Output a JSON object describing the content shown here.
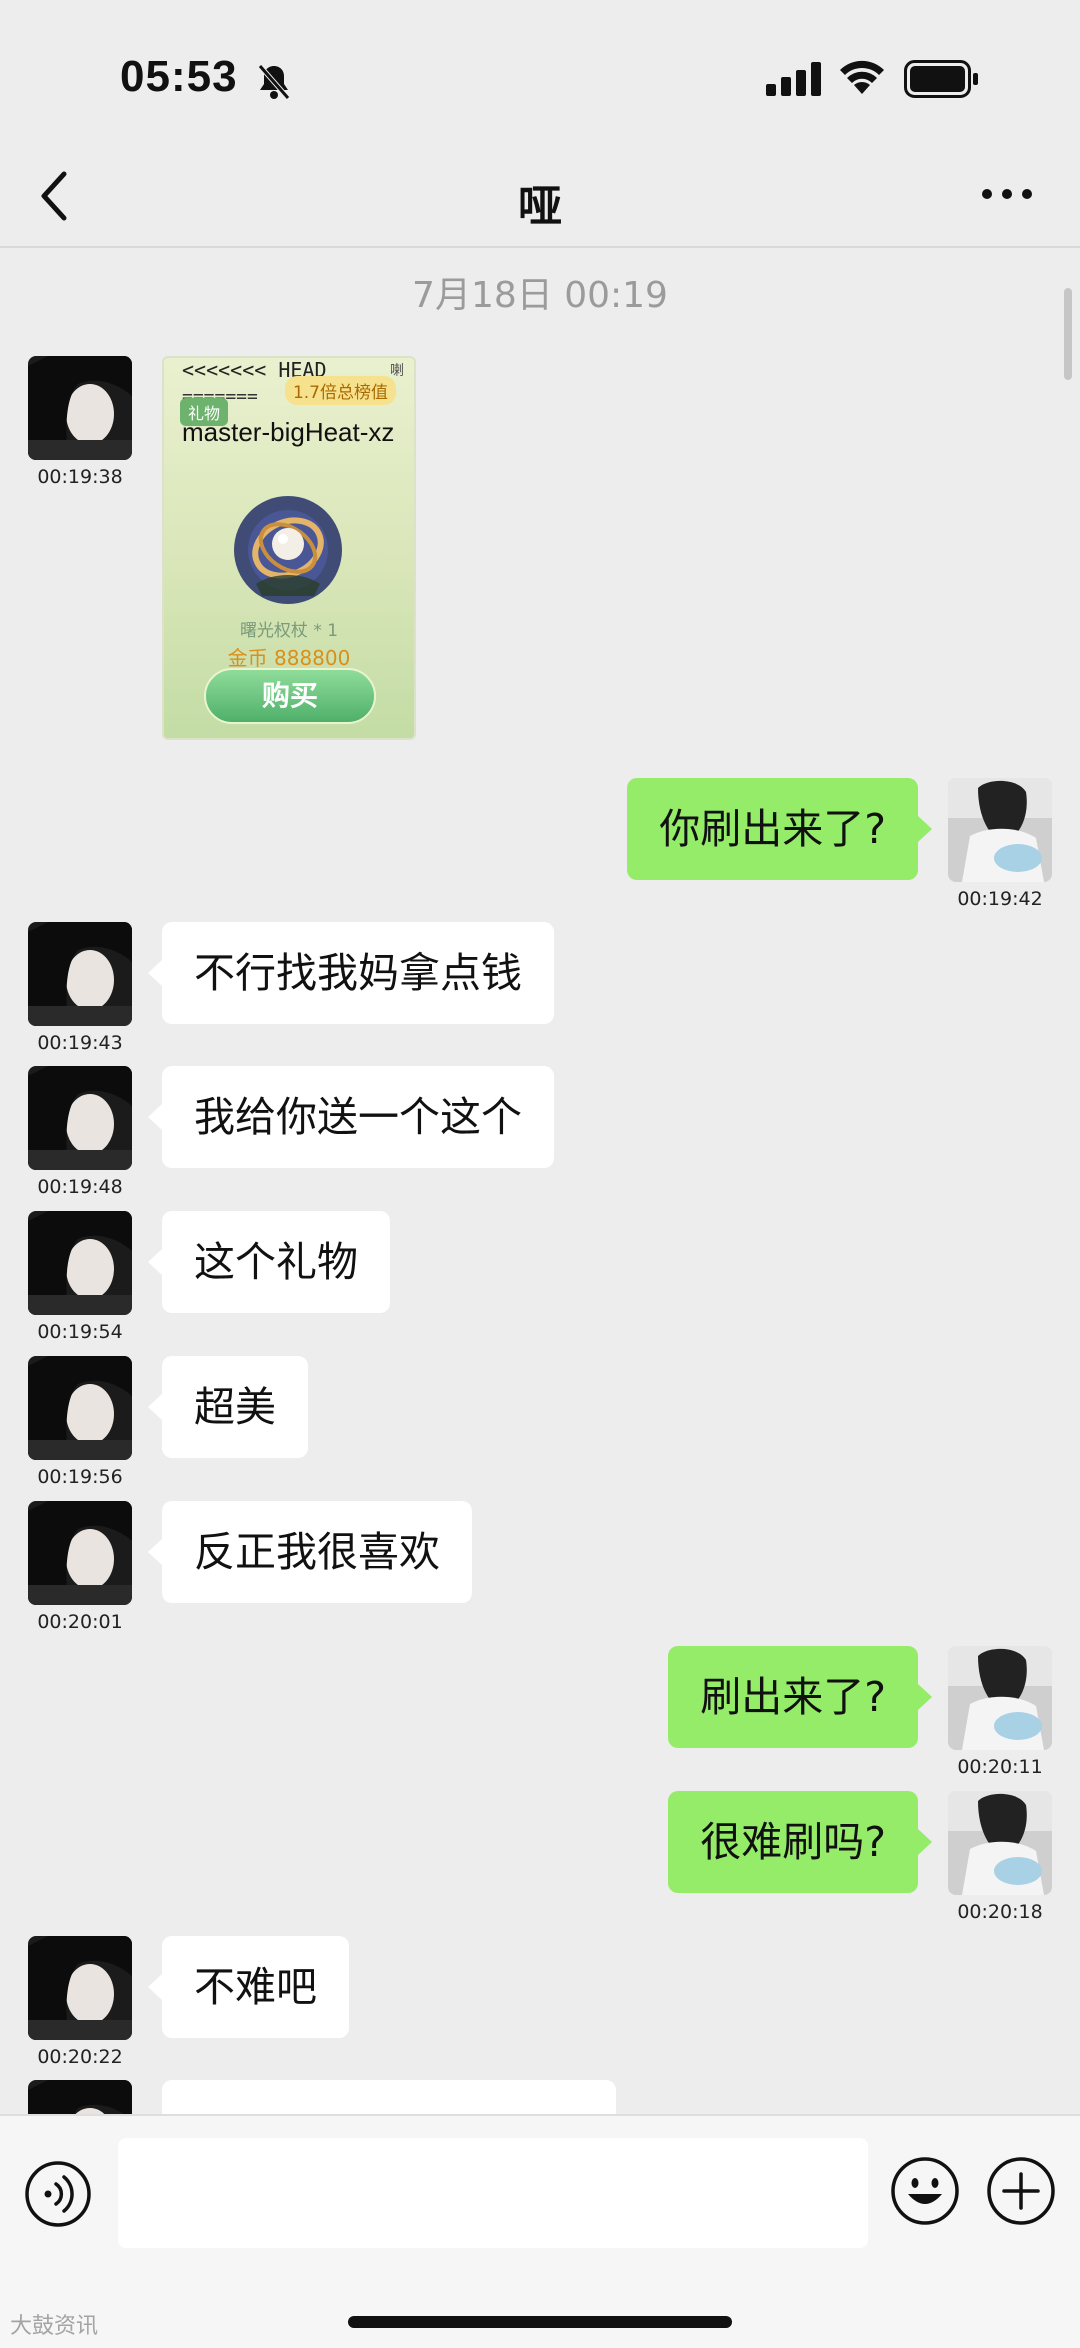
{
  "status_bar": {
    "time": "05:53"
  },
  "nav": {
    "title": "哑"
  },
  "chat": {
    "date": "7月18日 00:19",
    "gift_message": {
      "timestamp": "00:19:38",
      "head_text": "<<<<<<< HEAD",
      "separator_text": "=======",
      "badge": "1.7倍总榜值",
      "corner_text": "喇",
      "tag": "礼物",
      "name_text": "master-bigHeat-xz",
      "caption": "曙光权杖 * 1",
      "price": "金币 888800",
      "buy_label": "购买"
    },
    "messages": [
      {
        "side": "right",
        "text": "你刷出来了?",
        "time": "00:19:42"
      },
      {
        "side": "left",
        "text": "不行找我妈拿点钱",
        "time": "00:19:43"
      },
      {
        "side": "left",
        "text": "我给你送一个这个",
        "time": "00:19:48"
      },
      {
        "side": "left",
        "text": "这个礼物",
        "time": "00:19:54"
      },
      {
        "side": "left",
        "text": "超美",
        "time": "00:19:56"
      },
      {
        "side": "left",
        "text": "反正我很喜欢",
        "time": "00:20:01"
      },
      {
        "side": "right",
        "text": "刷出来了?",
        "time": "00:20:11"
      },
      {
        "side": "right",
        "text": "很难刷吗?",
        "time": "00:20:18"
      },
      {
        "side": "left",
        "text": "不难吧",
        "time": "00:20:22"
      }
    ]
  },
  "input": {
    "placeholder": ""
  },
  "watermark": "大鼓资讯",
  "colors": {
    "background": "#ededed",
    "sent_bubble": "#95ec69",
    "received_bubble": "#ffffff"
  },
  "icons": [
    "back-arrow-icon",
    "more-icon",
    "bell-slash-icon",
    "signal-icon",
    "wifi-icon",
    "battery-icon",
    "voice-icon",
    "emoji-icon",
    "plus-icon"
  ]
}
